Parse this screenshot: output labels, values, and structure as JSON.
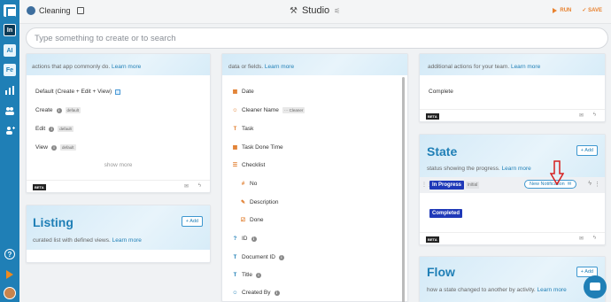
{
  "header": {
    "project_name": "Cleaning",
    "studio_title": "Studio",
    "run_label": "RUN",
    "save_label": "SAVE"
  },
  "rail": {
    "items": [
      "In",
      "AI",
      "Fe"
    ]
  },
  "search": {
    "placeholder": "Type something to create or to search"
  },
  "actions_card": {
    "description": "actions that app commonly do.",
    "learn_more": "Learn more",
    "rows": [
      {
        "label": "Default (Create + Edit + View)",
        "tag": ""
      },
      {
        "label": "Create",
        "tag": "default"
      },
      {
        "label": "Edit",
        "tag": "default"
      },
      {
        "label": "View",
        "tag": "default"
      }
    ],
    "show_more": "show more",
    "beta": "BETA"
  },
  "listing_card": {
    "title": "Listing",
    "add_label": "+ Add",
    "description": "curated list with defined views.",
    "learn_more": "Learn more"
  },
  "fields_card": {
    "description": "data or fields.",
    "learn_more": "Learn more",
    "fields": [
      {
        "label": "Date",
        "icon": "calendar-icon",
        "tag": ""
      },
      {
        "label": "Cleaner Name",
        "icon": "person-icon",
        "tag": "··· Cleaner"
      },
      {
        "label": "Task",
        "icon": "text-icon",
        "tag": ""
      },
      {
        "label": "Task Done Time",
        "icon": "calendar-icon",
        "tag": ""
      },
      {
        "label": "Checklist",
        "icon": "checklist-icon",
        "tag": ""
      },
      {
        "label": "No",
        "icon": "number-icon",
        "tag": ""
      },
      {
        "label": "Description",
        "icon": "pencil-icon",
        "tag": ""
      },
      {
        "label": "Done",
        "icon": "checkbox-icon",
        "tag": ""
      },
      {
        "label": "ID",
        "icon": "question-icon",
        "tag": ""
      },
      {
        "label": "Document ID",
        "icon": "text-icon",
        "tag": ""
      },
      {
        "label": "Title",
        "icon": "text-icon",
        "tag": ""
      },
      {
        "label": "Created By",
        "icon": "person-icon",
        "tag": ""
      }
    ]
  },
  "additional_card": {
    "description": "additional actions for your team.",
    "learn_more": "Learn more",
    "complete": "Complete",
    "beta": "BETA"
  },
  "state_card": {
    "title": "State",
    "add_label": "+ Add",
    "description": "status showing the progress.",
    "learn_more": "Learn more",
    "in_progress": "In Progress",
    "initial": "initial",
    "new_notification": "New Notification",
    "completed": "Completed",
    "beta": "BETA"
  },
  "flow_card": {
    "title": "Flow",
    "add_label": "+ Add",
    "description": "how a state changed to another by activity.",
    "learn_more": "Learn more"
  },
  "colors": {
    "brand": "#1f7fb6",
    "accent": "#e8812e",
    "state_pill": "#1f39b8"
  }
}
